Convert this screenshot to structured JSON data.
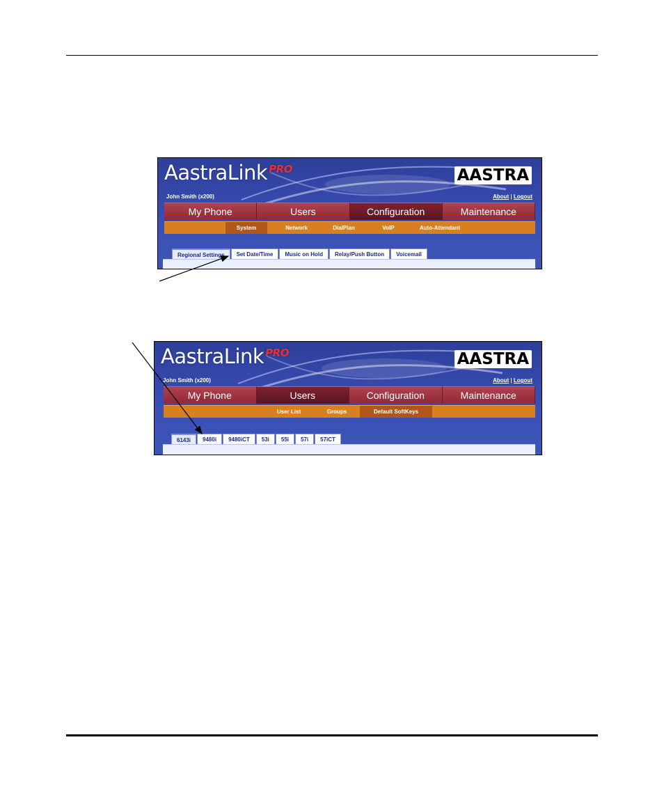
{
  "screenshot1": {
    "brand": "AastraLink",
    "brand_suffix": "PRO",
    "logo": "AASTRA",
    "user_label": "John Smith (x200)",
    "links": {
      "about": "About",
      "separator": "|",
      "logout": "Logout"
    },
    "main_tabs": [
      "My Phone",
      "Users",
      "Configuration",
      "Maintenance"
    ],
    "active_main_tab": "Configuration",
    "sub_tabs": [
      "System",
      "Network",
      "DialPlan",
      "VoIP",
      "Auto-Attendant"
    ],
    "active_sub_tab": "System",
    "page_tabs": [
      "Regional Settings",
      "Set Date/Time",
      "Music on Hold",
      "Relay/Push Button",
      "Voicemail"
    ],
    "active_page_tab": "Regional Settings"
  },
  "screenshot2": {
    "brand": "AastraLink",
    "brand_suffix": "PRO",
    "logo": "AASTRA",
    "user_label": "John Smith (x200)",
    "links": {
      "about": "About",
      "separator": "|",
      "logout": "Logout"
    },
    "main_tabs": [
      "My Phone",
      "Users",
      "Configuration",
      "Maintenance"
    ],
    "active_main_tab": "Users",
    "sub_tabs": [
      "User List",
      "Groups",
      "Default SoftKeys"
    ],
    "active_sub_tab": "Default SoftKeys",
    "page_tabs": [
      "6143i",
      "9480i",
      "9480iCT",
      "53i",
      "55i",
      "57i",
      "57iCT"
    ],
    "active_page_tab": "6143i"
  },
  "colors": {
    "banner": "#3447a8",
    "main_tab": "#a03a46",
    "main_tab_active": "#6e1c28",
    "sub_nav": "#d88020",
    "sub_nav_active": "#b0561c"
  }
}
